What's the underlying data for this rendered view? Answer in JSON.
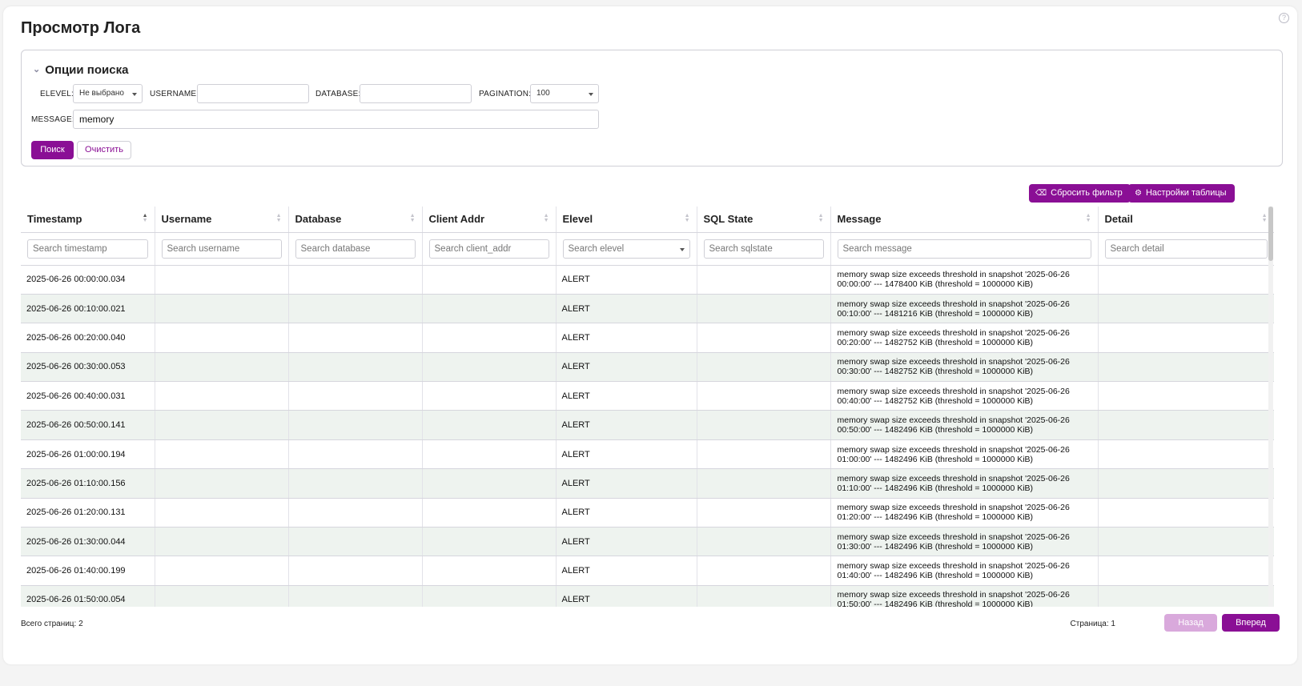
{
  "page": {
    "title": "Просмотр Лога",
    "help_icon": "?"
  },
  "search_options": {
    "title": "Опции поиска",
    "elevel_label": "ELEVEL:",
    "elevel_value": "Не выбрано",
    "username_label": "USERNAME:",
    "username_value": "",
    "database_label": "DATABASE:",
    "database_value": "",
    "pagination_label": "PAGINATION:",
    "pagination_value": "100",
    "message_label": "MESSAGE:",
    "message_value": "memory",
    "search_button": "Поиск",
    "clear_button": "Очистить"
  },
  "toolbar": {
    "reset_filter": "Сбросить фильтр",
    "table_settings": "Настройки таблицы"
  },
  "table": {
    "columns": [
      "Timestamp",
      "Username",
      "Database",
      "Client Addr",
      "Elevel",
      "SQL State",
      "Message",
      "Detail"
    ],
    "filters": [
      "Search timestamp",
      "Search username",
      "Search database",
      "Search client_addr",
      "Search elevel",
      "Search sqlstate",
      "Search message",
      "Search detail"
    ],
    "rows": [
      {
        "timestamp": "2025-06-26 00:00:00.034",
        "elevel": "ALERT",
        "message": "memory swap size exceeds threshold in snapshot '2025-06-26 00:00:00' --- 1478400 KiB (threshold = 1000000 KiB)"
      },
      {
        "timestamp": "2025-06-26 00:10:00.021",
        "elevel": "ALERT",
        "message": "memory swap size exceeds threshold in snapshot '2025-06-26 00:10:00' --- 1481216 KiB (threshold = 1000000 KiB)"
      },
      {
        "timestamp": "2025-06-26 00:20:00.040",
        "elevel": "ALERT",
        "message": "memory swap size exceeds threshold in snapshot '2025-06-26 00:20:00' --- 1482752 KiB (threshold = 1000000 KiB)"
      },
      {
        "timestamp": "2025-06-26 00:30:00.053",
        "elevel": "ALERT",
        "message": "memory swap size exceeds threshold in snapshot '2025-06-26 00:30:00' --- 1482752 KiB (threshold = 1000000 KiB)"
      },
      {
        "timestamp": "2025-06-26 00:40:00.031",
        "elevel": "ALERT",
        "message": "memory swap size exceeds threshold in snapshot '2025-06-26 00:40:00' --- 1482752 KiB (threshold = 1000000 KiB)"
      },
      {
        "timestamp": "2025-06-26 00:50:00.141",
        "elevel": "ALERT",
        "message": "memory swap size exceeds threshold in snapshot '2025-06-26 00:50:00' --- 1482496 KiB (threshold = 1000000 KiB)"
      },
      {
        "timestamp": "2025-06-26 01:00:00.194",
        "elevel": "ALERT",
        "message": "memory swap size exceeds threshold in snapshot '2025-06-26 01:00:00' --- 1482496 KiB (threshold = 1000000 KiB)"
      },
      {
        "timestamp": "2025-06-26 01:10:00.156",
        "elevel": "ALERT",
        "message": "memory swap size exceeds threshold in snapshot '2025-06-26 01:10:00' --- 1482496 KiB (threshold = 1000000 KiB)"
      },
      {
        "timestamp": "2025-06-26 01:20:00.131",
        "elevel": "ALERT",
        "message": "memory swap size exceeds threshold in snapshot '2025-06-26 01:20:00' --- 1482496 KiB (threshold = 1000000 KiB)"
      },
      {
        "timestamp": "2025-06-26 01:30:00.044",
        "elevel": "ALERT",
        "message": "memory swap size exceeds threshold in snapshot '2025-06-26 01:30:00' --- 1482496 KiB (threshold = 1000000 KiB)"
      },
      {
        "timestamp": "2025-06-26 01:40:00.199",
        "elevel": "ALERT",
        "message": "memory swap size exceeds threshold in snapshot '2025-06-26 01:40:00' --- 1482496 KiB (threshold = 1000000 KiB)"
      },
      {
        "timestamp": "2025-06-26 01:50:00.054",
        "elevel": "ALERT",
        "message": "memory swap size exceeds threshold in snapshot '2025-06-26 01:50:00' --- 1482496 KiB (threshold = 1000000 KiB)"
      }
    ]
  },
  "footer": {
    "total_pages": "Всего страниц: 2",
    "current_page": "Страница: 1",
    "prev_button": "Назад",
    "next_button": "Вперед"
  },
  "colors": {
    "accent": "#8a0f95",
    "accent_disabled": "#d9a9dc",
    "row_alt": "#eef3ef"
  }
}
